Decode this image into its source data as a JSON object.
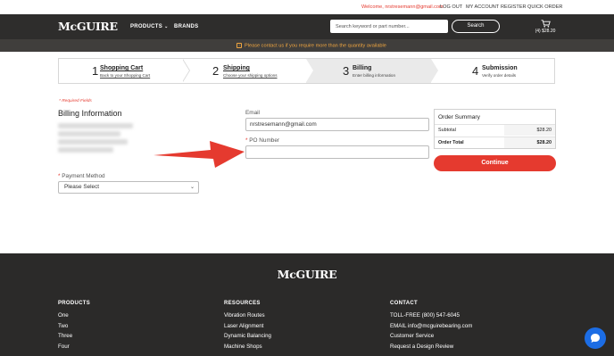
{
  "utility": {
    "welcome": "Welcome, nrstresemann@gmail.com",
    "logout": "LOG OUT",
    "account": "MY ACCOUNT",
    "register": "REGISTER",
    "quick_order": "QUICK ORDER"
  },
  "header": {
    "logo": "McGUIRE",
    "nav_products": "PRODUCTS",
    "nav_brands": "BRANDS",
    "search_placeholder": "Search keyword or part number...",
    "search_button": "Search",
    "cart_total": "(4) $28.20",
    "cart_icon": "shopping-cart-icon"
  },
  "notice": {
    "text": "Please contact us if you require more than the quantity available",
    "icon": "info-icon"
  },
  "steps": [
    {
      "num": "1",
      "title": "Shopping Cart",
      "sub": "Back to your Shopping Cart"
    },
    {
      "num": "2",
      "title": "Shipping",
      "sub": "Choose your shipping options"
    },
    {
      "num": "3",
      "title": "Billing",
      "sub": "Enter billing information"
    },
    {
      "num": "4",
      "title": "Submission",
      "sub": "Verify order details"
    }
  ],
  "form": {
    "required_note": "* Required Fields",
    "billing_title": "Billing Information",
    "email_label": "Email",
    "email_value": "nrstresemann@gmail.com",
    "po_star": "*",
    "po_label": "PO Number",
    "po_value": "",
    "payment_star": "*",
    "payment_label": "Payment Method",
    "payment_selected": "Please Select"
  },
  "summary": {
    "title": "Order Summary",
    "subtotal_label": "Subtotal",
    "subtotal_value": "$28.20",
    "total_label": "Order Total",
    "total_value": "$28.20",
    "continue_label": "Continue"
  },
  "footer": {
    "logo": "McGUIRE",
    "columns": [
      {
        "title": "PRODUCTS",
        "links": [
          "One",
          "Two",
          "Three",
          "Four"
        ]
      },
      {
        "title": "RESOURCES",
        "links": [
          "Vibration Routes",
          "Laser Alignment",
          "Dynamic Balancing",
          "Machine Shops"
        ]
      },
      {
        "title": "CONTACT",
        "links": [
          "TOLL-FREE (800) 547-6045",
          "EMAIL info@mcguirebearing.com",
          "Customer Service",
          "Request a Design Review"
        ]
      }
    ]
  },
  "colors": {
    "accent_red": "#e53a2f",
    "header_dark": "#2e2d2c",
    "notice_orange": "#f0a640",
    "chat_blue": "#1c6de5"
  }
}
